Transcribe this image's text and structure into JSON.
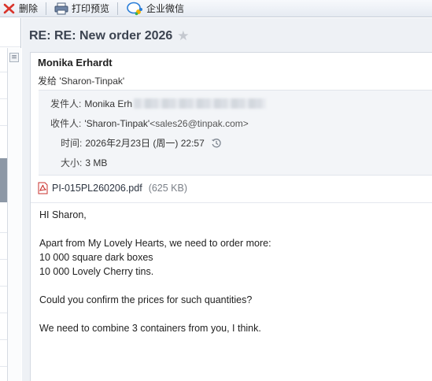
{
  "toolbar": {
    "delete_label": "删除",
    "print_preview_label": "打印预览",
    "wecom_label": "企业微信",
    "icons": {
      "delete": "delete-x-icon",
      "print": "printer-icon",
      "wecom": "wecom-chat-icon"
    }
  },
  "email": {
    "subject": "RE: RE: New order 2026",
    "sender_name": "Monika Erhardt",
    "sent_to_line": "发给 'Sharon-Tinpak'",
    "details": {
      "from_label": "发件人:",
      "from_value": "Monika Erh",
      "to_label": "收件人:",
      "to_name": "'Sharon-Tinpak'",
      "to_address": "<sales26@tinpak.com>",
      "time_label": "时间:",
      "time_value": "2026年2月23日 (周一) 22:57",
      "size_label": "大小:",
      "size_value": "3 MB"
    },
    "attachment": {
      "name": "PI-015PL260206.pdf",
      "size": "(625 KB)"
    },
    "body": {
      "greeting": "HI Sharon,",
      "line1": "Apart from My Lovely Hearts, we need to order more:",
      "line2": "10 000 square dark boxes",
      "line3": "10 000 Lovely Cherry tins.",
      "line4": "Could you confirm the prices for such quantities?",
      "line5": "We need to combine 3 containers from you, I think."
    }
  },
  "colors": {
    "accent_red": "#d9342b",
    "toolbar_bg": "#e9eef4",
    "pane_bg": "#eef1f5"
  }
}
